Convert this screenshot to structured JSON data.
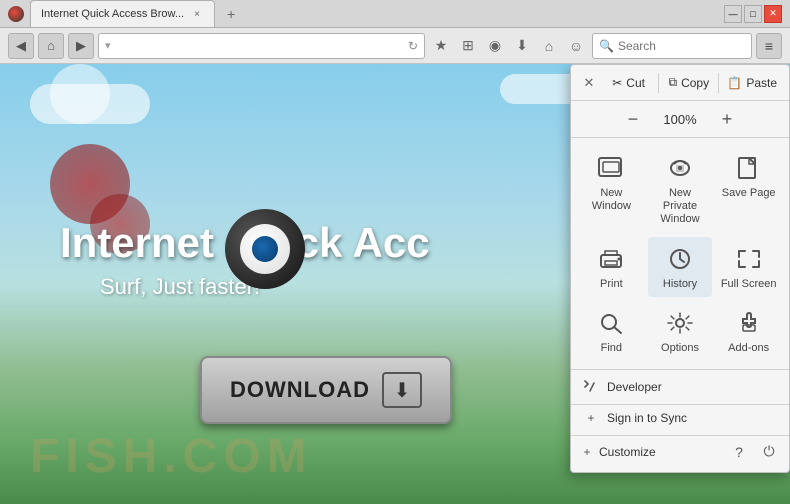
{
  "browser": {
    "title": "Internet Quick Access Brow...",
    "tab_close": "×",
    "tab_new": "+",
    "nav": {
      "back": "◀",
      "home": "⌂",
      "forward": "▶",
      "url_placeholder": "",
      "search_placeholder": "Search"
    },
    "window_controls": {
      "minimize": "—",
      "maximize": "□",
      "close": "✕"
    }
  },
  "website": {
    "title": "Internet Quick Acc",
    "subtitle": "Surf, Just faster!",
    "download_btn": "DOWNLOAD",
    "watermark": "FISH.COM"
  },
  "menu": {
    "cut_label": "Cut",
    "copy_label": "Copy",
    "paste_label": "Paste",
    "zoom_minus": "−",
    "zoom_value": "100%",
    "zoom_plus": "+",
    "items": [
      {
        "id": "new-window",
        "label": "New Window",
        "icon": "window"
      },
      {
        "id": "new-private-window",
        "label": "New Private\nWindow",
        "icon": "private"
      },
      {
        "id": "save-page",
        "label": "Save Page",
        "icon": "save"
      },
      {
        "id": "print",
        "label": "Print",
        "icon": "print"
      },
      {
        "id": "history",
        "label": "History",
        "icon": "history"
      },
      {
        "id": "full-screen",
        "label": "Full Screen",
        "icon": "fullscreen"
      },
      {
        "id": "find",
        "label": "Find",
        "icon": "find"
      },
      {
        "id": "options",
        "label": "Options",
        "icon": "options"
      },
      {
        "id": "add-ons",
        "label": "Add-ons",
        "icon": "addons"
      }
    ],
    "developer_label": "Developer",
    "sign_in_label": "Sign in to Sync",
    "customize_label": "Customize",
    "help_icon": "?",
    "exit_icon": "⏻",
    "close_icon": "✕",
    "colors": {
      "panel_bg": "#f5f5f5",
      "selected_bg": "#e0e8f0",
      "border": "#c0c0c0"
    }
  }
}
